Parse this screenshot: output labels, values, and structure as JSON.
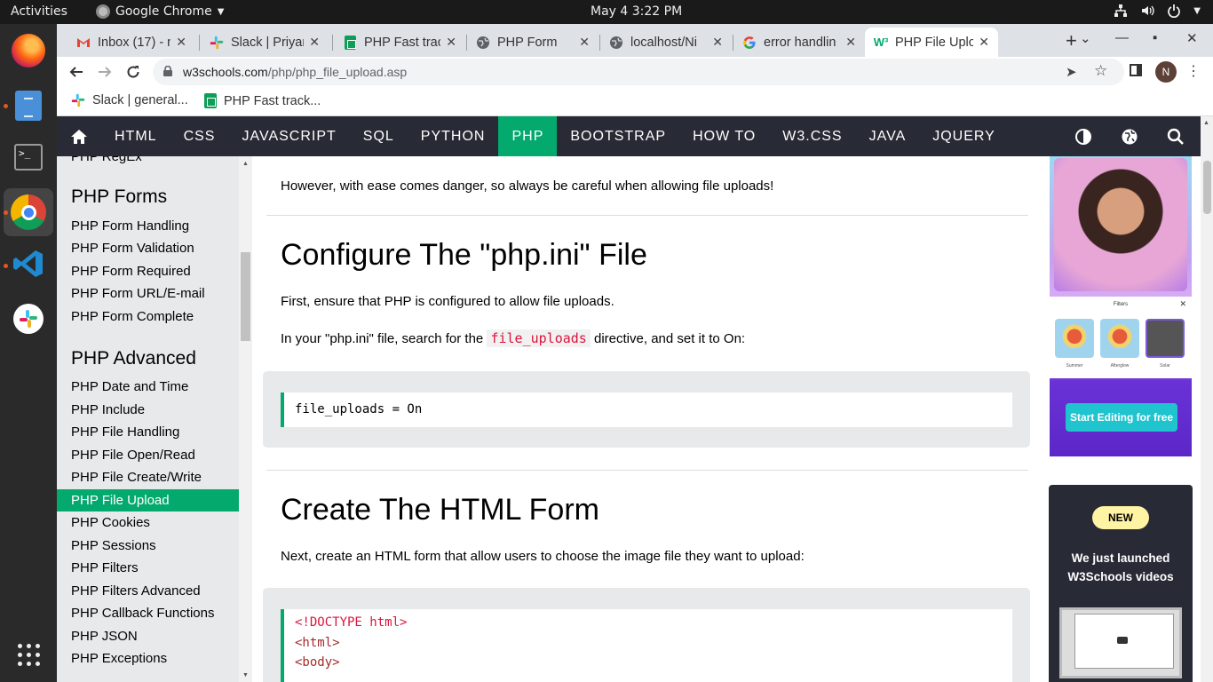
{
  "system": {
    "activities": "Activities",
    "app_name": "Google Chrome",
    "clock": "May 4   3:22 PM"
  },
  "tabs": [
    {
      "title": "Inbox (17) - n",
      "icon": "gmail-icon"
    },
    {
      "title": "Slack | Priyan",
      "icon": "slack-icon"
    },
    {
      "title": "PHP Fast trac",
      "icon": "sheets-icon"
    },
    {
      "title": "PHP Form",
      "icon": "globe-icon"
    },
    {
      "title": "localhost/Ni",
      "icon": "globe-icon"
    },
    {
      "title": "error handlin",
      "icon": "google-icon"
    },
    {
      "title": "PHP File Uplo",
      "icon": "w3schools-icon",
      "active": true
    }
  ],
  "address_bar": {
    "domain": "w3schools.com",
    "path": "/php/php_file_upload.asp"
  },
  "profile_initial": "N",
  "bookmarks": [
    {
      "label": "Slack | general...",
      "icon": "slack-icon"
    },
    {
      "label": "PHP Fast track...",
      "icon": "sheets-icon"
    }
  ],
  "w3nav": {
    "items": [
      "HTML",
      "CSS",
      "JAVASCRIPT",
      "SQL",
      "PYTHON",
      "PHP",
      "BOOTSTRAP",
      "HOW TO",
      "W3.CSS",
      "JAVA",
      "JQUERY"
    ],
    "active": "PHP",
    "active_color": "#04aa6d"
  },
  "sidebar": {
    "partial_item": "PHP RegEx",
    "sections": [
      {
        "heading": "PHP Forms",
        "links": [
          "PHP Form Handling",
          "PHP Form Validation",
          "PHP Form Required",
          "PHP Form URL/E-mail",
          "PHP Form Complete"
        ]
      },
      {
        "heading": "PHP Advanced",
        "links": [
          "PHP Date and Time",
          "PHP Include",
          "PHP File Handling",
          "PHP File Open/Read",
          "PHP File Create/Write",
          "PHP File Upload",
          "PHP Cookies",
          "PHP Sessions",
          "PHP Filters",
          "PHP Filters Advanced",
          "PHP Callback Functions",
          "PHP JSON",
          "PHP Exceptions"
        ]
      }
    ],
    "active_link": "PHP File Upload"
  },
  "content": {
    "intro": "However, with ease comes danger, so always be careful when allowing file uploads!",
    "h1": "Configure The \"php.ini\" File",
    "p1": "First, ensure that PHP is configured to allow file uploads.",
    "p2_before": "In your \"php.ini\" file, search for the",
    "p2_code": "file_uploads",
    "p2_after": "directive, and set it to On:",
    "code1": "file_uploads = On",
    "h2": "Create The HTML Form",
    "p3": "Next, create an HTML form that allow users to choose the image file they want to upload:",
    "code2": [
      "<!DOCTYPE html>",
      "<html>",
      "<body>"
    ]
  },
  "ads": {
    "filters_title": "Filters",
    "filter_labels": [
      "Summer",
      "Afterglow",
      "Solar"
    ],
    "cta": "Start Editing for free",
    "badge": "NEW",
    "headline_line1": "We just launched",
    "headline_line2": "W3Schools videos"
  }
}
